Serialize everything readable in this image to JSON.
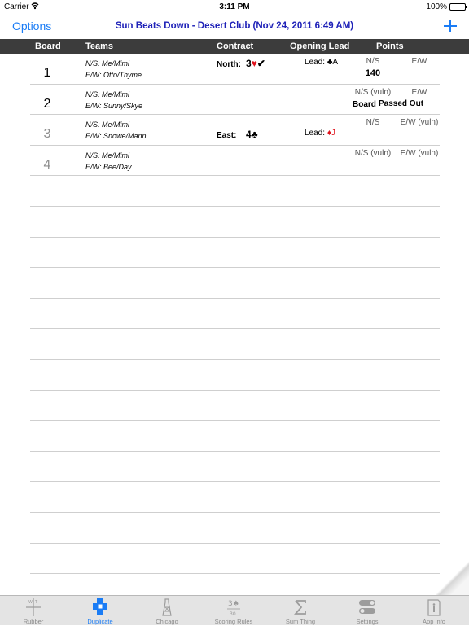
{
  "status_bar": {
    "carrier": "Carrier",
    "time": "3:11 PM",
    "battery": "100%"
  },
  "nav": {
    "options_label": "Options",
    "title": "Sun Beats Down - Desert Club (Nov 24, 2011 6:49 AM)",
    "add_icon": "plus-icon"
  },
  "columns": {
    "board": "Board",
    "teams": "Teams",
    "contract": "Contract",
    "opening_lead": "Opening Lead",
    "points": "Points"
  },
  "rows": [
    {
      "board": "1",
      "dim": false,
      "ns_team": "N/S: Me/Mimi",
      "ew_team": "E/W: Otto/Thyme",
      "declarer": "North:",
      "contract_level": "3",
      "contract_suit": "♥",
      "contract_mark": "✔",
      "lead_label": "Lead:",
      "lead_suit": "♣",
      "lead_card": "A",
      "ns_header": "N/S",
      "ew_header": "E/W",
      "ns_points": "140",
      "ew_points": ""
    },
    {
      "board": "2",
      "dim": false,
      "ns_team": "N/S: Me/Mimi",
      "ew_team": "E/W: Sunny/Skye",
      "ns_header": "N/S (vuln)",
      "ew_header": "E/W",
      "board_note": "Board",
      "passed_note": "Passed Out"
    },
    {
      "board": "3",
      "dim": true,
      "ns_team": "N/S: Me/Mimi",
      "ew_team": "E/W: Snowe/Mann",
      "declarer": "East:",
      "contract_level": "4",
      "contract_suit": "♣",
      "lead_label": "Lead:",
      "lead_suit": "♦",
      "lead_card": "J",
      "ns_header": "N/S",
      "ew_header": "E/W (vuln)"
    },
    {
      "board": "4",
      "dim": true,
      "ns_team": "N/S: Me/Mimi",
      "ew_team": "E/W: Bee/Day",
      "ns_header": "N/S (vuln)",
      "ew_header": "E/W (vuln)"
    }
  ],
  "empty_rows": 14,
  "tabs": [
    {
      "label": "Rubber",
      "icon": "rubber-scorepad-icon",
      "active": false
    },
    {
      "label": "Duplicate",
      "icon": "duplicate-boards-icon",
      "active": true
    },
    {
      "label": "Chicago",
      "icon": "chicago-tower-icon",
      "active": false
    },
    {
      "label": "Scoring Rules",
      "icon": "scoring-rules-icon",
      "active": false
    },
    {
      "label": "Sum Thing",
      "icon": "sigma-icon",
      "active": false
    },
    {
      "label": "Settings",
      "icon": "toggle-settings-icon",
      "active": false
    },
    {
      "label": "App Info",
      "icon": "info-icon",
      "active": false
    }
  ],
  "colors": {
    "accent": "#1a7cf5",
    "title": "#1f22b8",
    "header_bg": "#3c3c3c",
    "red_suit": "#e0111b"
  }
}
